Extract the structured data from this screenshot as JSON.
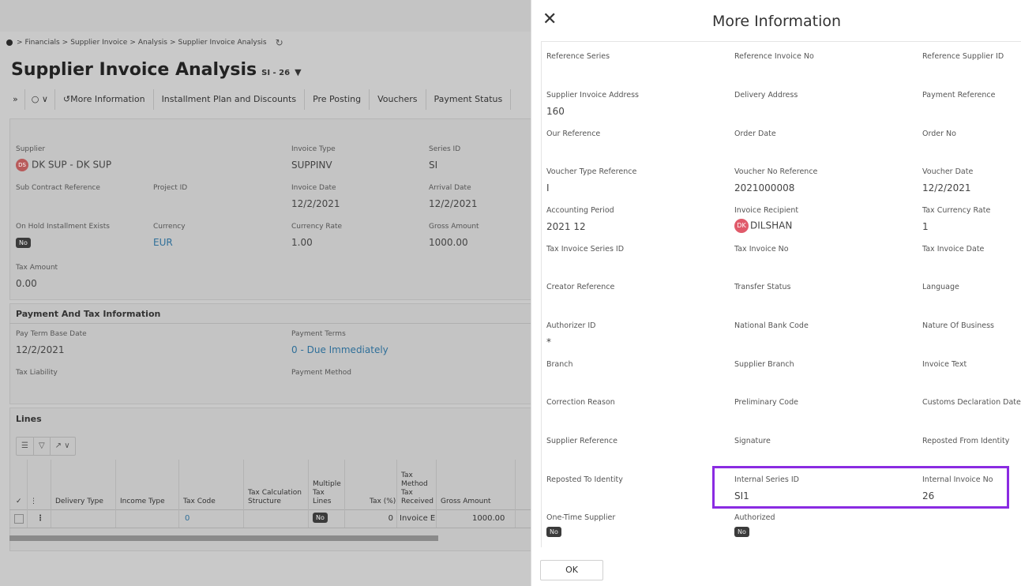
{
  "breadcrumb": [
    "Financials",
    "Supplier Invoice",
    "Analysis",
    "Supplier Invoice Analysis"
  ],
  "page": {
    "title": "Supplier Invoice Analysis",
    "record": "SI - 26"
  },
  "commands": [
    "More Information",
    "Installment Plan and Discounts",
    "Pre Posting",
    "Vouchers",
    "Payment Status"
  ],
  "header_fields": {
    "supplier_label": "Supplier",
    "supplier_avatar": "DS",
    "supplier_value": "DK SUP - DK SUP",
    "invoice_type_label": "Invoice Type",
    "invoice_type_value": "SUPPINV",
    "series_id_label": "Series ID",
    "series_id_value": "SI",
    "sub_contract_label": "Sub Contract Reference",
    "project_id_label": "Project ID",
    "invoice_date_label": "Invoice Date",
    "invoice_date_value": "12/2/2021",
    "arrival_date_label": "Arrival Date",
    "arrival_date_value": "12/2/2021",
    "on_hold_label": "On Hold Installment Exists",
    "on_hold_value": "No",
    "currency_label": "Currency",
    "currency_value": "EUR",
    "currency_rate_label": "Currency Rate",
    "currency_rate_value": "1.00",
    "gross_amount_label": "Gross Amount",
    "gross_amount_value": "1000.00",
    "tax_amount_label": "Tax Amount",
    "tax_amount_value": "0.00"
  },
  "payment_section": {
    "title": "Payment And Tax Information",
    "pay_term_label": "Pay Term Base Date",
    "pay_term_value": "12/2/2021",
    "payment_terms_label": "Payment Terms",
    "payment_terms_value": "0 - Due Immediately",
    "tax_liability_label": "Tax Liability",
    "payment_method_label": "Payment Method"
  },
  "lines": {
    "title": "Lines",
    "columns": [
      "Delivery Type",
      "Income Type",
      "Tax Code",
      "Tax Calculation Structure",
      "Multiple Tax Lines",
      "Tax (%)",
      "Tax Method Tax Received",
      "Gross Amount"
    ],
    "row": {
      "tax_code": "0",
      "multiple_tax_lines": "No",
      "tax_pct": "0",
      "tax_method": "Invoice E",
      "gross_amount": "1000.00"
    }
  },
  "dialog": {
    "title": "More Information",
    "ok_label": "OK",
    "fields": [
      {
        "label": "Reference Series",
        "value": ""
      },
      {
        "label": "Reference Invoice No",
        "value": ""
      },
      {
        "label": "Reference Supplier ID",
        "value": ""
      },
      {
        "label": "Supplier Invoice Address",
        "value": "160"
      },
      {
        "label": "Delivery Address",
        "value": ""
      },
      {
        "label": "Payment Reference",
        "value": ""
      },
      {
        "label": "Our Reference",
        "value": ""
      },
      {
        "label": "Order Date",
        "value": ""
      },
      {
        "label": "Order No",
        "value": ""
      },
      {
        "label": "Voucher Type Reference",
        "value": "I"
      },
      {
        "label": "Voucher No Reference",
        "value": "2021000008"
      },
      {
        "label": "Voucher Date",
        "value": "12/2/2021"
      },
      {
        "label": "Accounting Period",
        "value": "2021 12"
      },
      {
        "label": "Invoice Recipient",
        "value": "DILSHAN",
        "avatar": "DK"
      },
      {
        "label": "Tax Currency Rate",
        "value": "1"
      },
      {
        "label": "Tax Invoice Series ID",
        "value": ""
      },
      {
        "label": "Tax Invoice No",
        "value": ""
      },
      {
        "label": "Tax Invoice Date",
        "value": ""
      },
      {
        "label": "Creator Reference",
        "value": ""
      },
      {
        "label": "Transfer Status",
        "value": ""
      },
      {
        "label": "Language",
        "value": ""
      },
      {
        "label": "Authorizer ID",
        "value": "*"
      },
      {
        "label": "National Bank Code",
        "value": ""
      },
      {
        "label": "Nature Of Business",
        "value": ""
      },
      {
        "label": "Branch",
        "value": ""
      },
      {
        "label": "Supplier Branch",
        "value": ""
      },
      {
        "label": "Invoice Text",
        "value": ""
      },
      {
        "label": "Correction Reason",
        "value": ""
      },
      {
        "label": "Preliminary Code",
        "value": ""
      },
      {
        "label": "Customs Declaration Date",
        "value": ""
      },
      {
        "label": "Supplier Reference",
        "value": ""
      },
      {
        "label": "Signature",
        "value": ""
      },
      {
        "label": "Reposted From Identity",
        "value": ""
      },
      {
        "label": "Reposted To Identity",
        "value": ""
      },
      {
        "label": "Internal Series ID",
        "value": "SI1"
      },
      {
        "label": "Internal Invoice No",
        "value": "26"
      },
      {
        "label": "One-Time Supplier",
        "value": "No",
        "badge": true
      },
      {
        "label": "Authorized",
        "value": "No",
        "badge": true
      }
    ]
  },
  "colors": {
    "highlight": "#8a2be2",
    "link": "#2f6f99"
  }
}
